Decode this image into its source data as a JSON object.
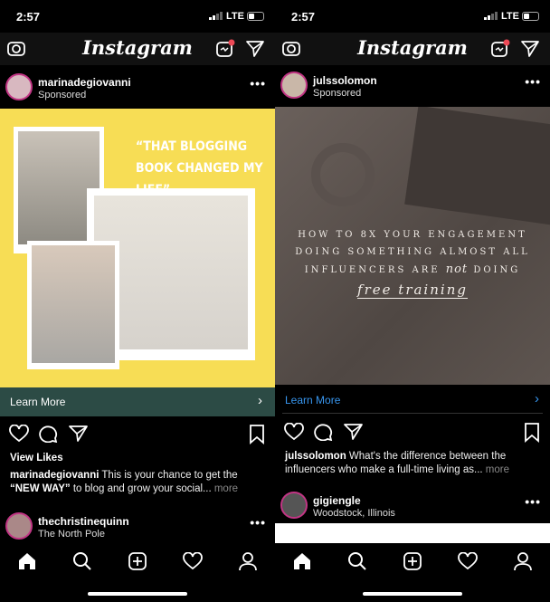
{
  "status": {
    "time": "2:57",
    "network": "LTE"
  },
  "app": {
    "logo": "Instagram"
  },
  "left": {
    "post": {
      "username": "marinadegiovanni",
      "subtitle": "Sponsored",
      "ad_headline": "“THAT BLOGGING BOOK CHANGED MY LIFE”",
      "cta": "Learn More",
      "cta_bg": "#2c4b45",
      "likes": "View Likes",
      "caption_user": "marinadegiovanni",
      "caption_text": " This is your chance to get the ",
      "caption_bold": "“NEW WAY”",
      "caption_text2": " to blog and grow your social...",
      "more": " more"
    },
    "next": {
      "username": "thechristinequinn",
      "subtitle": "The North Pole"
    }
  },
  "right": {
    "post": {
      "username": "julssolomon",
      "subtitle": "Sponsored",
      "ad_line1": "HOW TO 8X YOUR ENGAGEMENT",
      "ad_line2": "DOING SOMETHING ALMOST ALL",
      "ad_line3a": "INFLUENCERS ARE ",
      "ad_line3b": "not",
      "ad_line3c": " DOING",
      "ad_line4": "free training",
      "cta": "Learn More",
      "cta_color": "#3897f0",
      "caption_user": "julssolomon",
      "caption_text": " What's the difference between the influencers who make a full-time living as...",
      "more": " more"
    },
    "next": {
      "username": "gigiengle",
      "subtitle": "Woodstock, Illinois"
    }
  },
  "nav": [
    "home-icon",
    "search-icon",
    "add-icon",
    "heart-icon",
    "profile-icon"
  ]
}
